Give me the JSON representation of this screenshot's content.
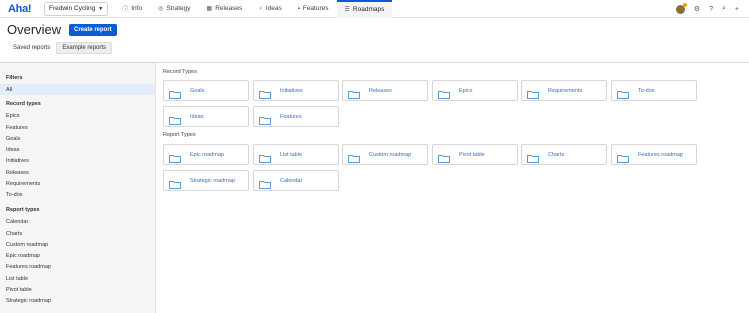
{
  "app": {
    "logo": "Aha!",
    "workspace": "Fredwin Cycling"
  },
  "nav": {
    "items": [
      {
        "label": "Info",
        "icon": "info-icon"
      },
      {
        "label": "Strategy",
        "icon": "strategy-icon"
      },
      {
        "label": "Releases",
        "icon": "calendar-icon"
      },
      {
        "label": "Ideas",
        "icon": "lightbulb-icon"
      },
      {
        "label": "Features",
        "icon": "grid-icon"
      },
      {
        "label": "Roadmaps",
        "icon": "roadmap-icon"
      }
    ],
    "active": "Roadmaps",
    "right_icons": [
      "avatar",
      "settings-icon",
      "help-icon",
      "search-icon",
      "add-icon"
    ]
  },
  "header": {
    "title": "Overview",
    "create_button": "Create report",
    "tabs": [
      "Saved reports",
      "Example reports"
    ],
    "active_tab": "Example reports"
  },
  "sidebar": {
    "filters_heading": "Filters",
    "all_label": "All",
    "record_types_heading": "Record types",
    "record_types": [
      "Epics",
      "Features",
      "Goals",
      "Ideas",
      "Initiatives",
      "Releases",
      "Requirements",
      "To-dos"
    ],
    "report_types_heading": "Report types",
    "report_types": [
      "Calendar",
      "Charts",
      "Custom roadmap",
      "Epic roadmap",
      "Features roadmap",
      "List table",
      "Pivot table",
      "Strategic roadmap"
    ]
  },
  "main": {
    "record_types_title": "Record Types",
    "record_cards": [
      "Goals",
      "Initiatives",
      "Releases",
      "Epics",
      "Requirements",
      "To-dos",
      "Ideas",
      "Features"
    ],
    "report_types_title": "Report Types",
    "report_cards": [
      "Epic roadmap",
      "List table",
      "Custom roadmap",
      "Pivot table",
      "Charts",
      "Features roadmap",
      "Strategic roadmap",
      "Calendar"
    ]
  },
  "colors": {
    "brand": "#0b5bd3",
    "card_label": "#3a6fc0",
    "folder": "#5b9bd5",
    "selected_bg": "#e3edf9"
  }
}
